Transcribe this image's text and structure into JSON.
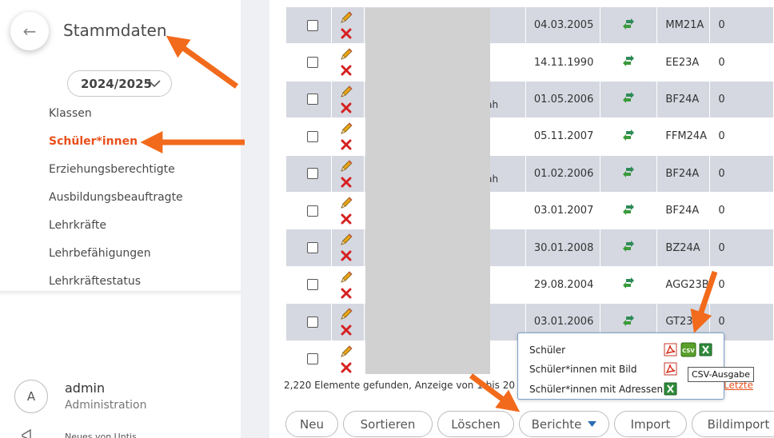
{
  "sidebar": {
    "back_icon": "arrow-left-icon",
    "title": "Stammdaten",
    "year": "2024/2025",
    "nav": [
      "Klassen",
      "Schüler*innen",
      "Erziehungsberechtigte",
      "Ausbildungsbeauftragte",
      "Lehrkräfte",
      "Lehrbefähigungen",
      "Lehrkräftestatus"
    ],
    "active_nav": "Schüler*innen",
    "user": {
      "initial": "A",
      "name": "admin",
      "role": "Administration"
    },
    "news": "Neues von Untis"
  },
  "table": {
    "rows": [
      {
        "name": "",
        "date": "04.03.2005",
        "class": "MM21A",
        "num": "0"
      },
      {
        "name": "",
        "date": "14.11.1990",
        "class": "EE23A",
        "num": "0"
      },
      {
        "name": "llah",
        "date": "01.05.2006",
        "class": "BF24A",
        "num": "0"
      },
      {
        "name": "",
        "date": "05.11.2007",
        "class": "FFM24A",
        "num": "0"
      },
      {
        "name": "llah",
        "date": "01.02.2006",
        "class": "BF24A",
        "num": "0"
      },
      {
        "name": "",
        "date": "03.01.2007",
        "class": "BF24A",
        "num": "0"
      },
      {
        "name": "",
        "date": "30.01.2008",
        "class": "BZ24A",
        "num": "0"
      },
      {
        "name": "",
        "date": "29.08.2004",
        "class": "AGG23B",
        "num": "0"
      },
      {
        "name": "",
        "date": "03.01.2006",
        "class": "GT23",
        "num": "0"
      },
      {
        "name": "",
        "date": "",
        "class": "",
        "num": ""
      }
    ],
    "footer": "2,220 Elemente gefunden, Anzeige von 1 bis 20",
    "footer_link": "Letzte"
  },
  "buttons": {
    "new": "Neu",
    "sort": "Sortieren",
    "delete": "Löschen",
    "reports": "Berichte",
    "import": "Import",
    "image_import": "Bildimport"
  },
  "reports_menu": {
    "items": [
      "Schüler",
      "Schüler*innen mit Bild",
      "Schüler*innen mit Adressen"
    ],
    "tooltip": "CSV-Ausgabe",
    "csv_label": "CSV"
  },
  "colors": {
    "accent": "#e8501c",
    "row_stripe": "#d5d8e1",
    "annotation_arrow": "#f26a1b"
  }
}
